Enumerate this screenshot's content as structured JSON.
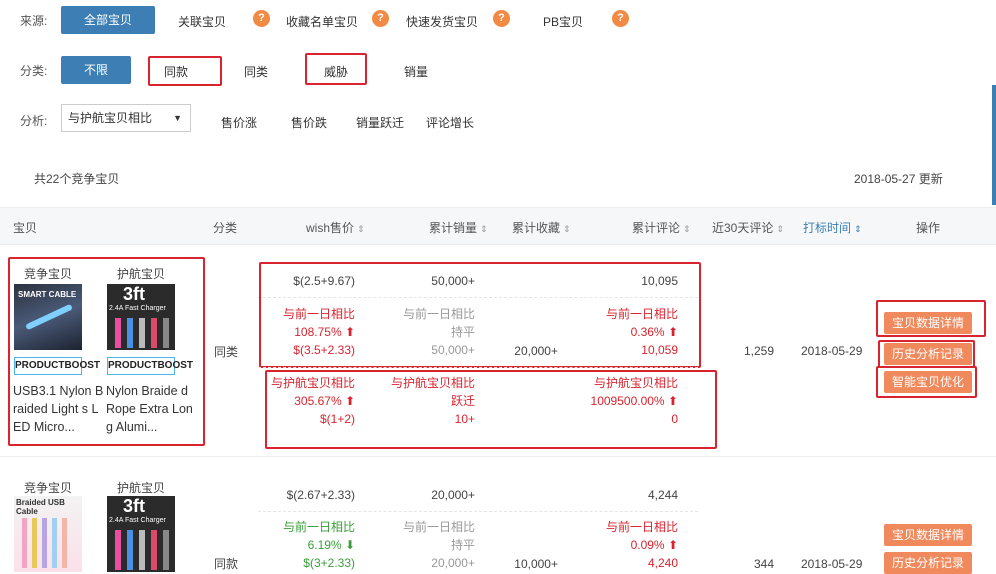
{
  "filters": {
    "source_label": "来源:",
    "source_options": [
      "全部宝贝",
      "关联宝贝",
      "收藏名单宝贝",
      "快速发货宝贝",
      "PB宝贝"
    ],
    "category_label": "分类:",
    "category_options": [
      "不限",
      "同款",
      "同类",
      "威胁",
      "销量"
    ],
    "analysis_label": "分析:",
    "analysis_select": "与护航宝贝相比",
    "analysis_options": [
      "售价涨",
      "售价跌",
      "销量跃迁",
      "评论增长"
    ]
  },
  "summary": {
    "count_text": "共22个竞争宝贝",
    "update_text": "2018-05-27 更新"
  },
  "table": {
    "headers": [
      "宝贝",
      "分类",
      "wish售价",
      "累计销量",
      "累计收藏",
      "累计评论",
      "近30天评论",
      "打标时间",
      "操作"
    ]
  },
  "rows": [
    {
      "competitor_label": "竞争宝贝",
      "escort_label": "护航宝贝",
      "competitor_img_text": "SMART CABLE",
      "escort_img_text": "3ft",
      "escort_img_sub": "2.4A Fast Charger",
      "competitor_badge": "PRODUCTBOOST",
      "escort_badge": "PRODUCTBOOST",
      "competitor_name": "USB3.1 Nylon Braided Light s LED Micro...",
      "escort_name": "Nylon Braide d Rope Extra Long Alumi...",
      "category": "同类",
      "price": "$(2.5+9.67)",
      "sales": "50,000+",
      "reviews": "10,095",
      "day_compare_label": "与前一日相比",
      "price_day_pct": "108.75% ⬆",
      "price_day_val": "$(3.5+2.33)",
      "sales_day_label": "与前一日相比",
      "sales_day_status": "持平",
      "sales_day_val": "50,000+",
      "favorites": "20,000+",
      "reviews_day_label": "与前一日相比",
      "reviews_day_pct": "0.36% ⬆",
      "reviews_day_val": "10,059",
      "recent_reviews": "1,259",
      "tag_date": "2018-05-29",
      "escort_compare_label": "与护航宝贝相比",
      "price_escort_pct": "305.67% ⬆",
      "price_escort_val": "$(1+2)",
      "sales_escort_label": "与护航宝贝相比",
      "sales_escort_status": "跃迁",
      "sales_escort_val": "10+",
      "reviews_escort_label": "与护航宝贝相比",
      "reviews_escort_pct": "1009500.00% ⬆",
      "reviews_escort_val": "0",
      "actions": [
        "宝贝数据详情",
        "历史分析记录",
        "智能宝贝优化"
      ]
    },
    {
      "competitor_label": "竞争宝贝",
      "escort_label": "护航宝贝",
      "competitor_img_text": "Braided USB Cable",
      "escort_img_text": "3ft",
      "escort_img_sub": "2.4A Fast Charger",
      "category": "同款",
      "price": "$(2.67+2.33)",
      "sales": "20,000+",
      "reviews": "4,244",
      "day_compare_label": "与前一日相比",
      "price_day_pct": "6.19% ⬇",
      "price_day_val": "$(3+2.33)",
      "sales_day_label": "与前一日相比",
      "sales_day_status": "持平",
      "sales_day_val": "20,000+",
      "favorites": "10,000+",
      "reviews_day_label": "与前一日相比",
      "reviews_day_pct": "0.09% ⬆",
      "reviews_day_val": "4,240",
      "recent_reviews": "344",
      "tag_date": "2018-05-29",
      "actions": [
        "宝贝数据详情",
        "历史分析记录"
      ]
    }
  ],
  "colors": {
    "primary": "#3d7fb4",
    "orange": "#f08a5d",
    "up_red": "#d9232e",
    "down_green": "#3a9f3a"
  }
}
